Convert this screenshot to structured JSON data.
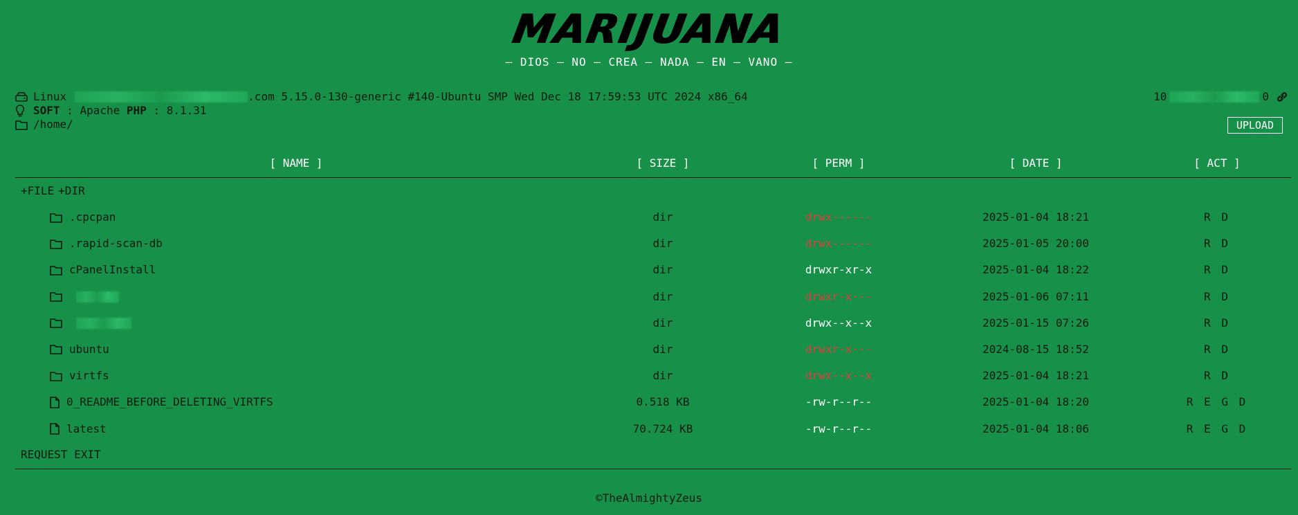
{
  "header": {
    "logo": "MARIJUANA",
    "tagline": "— DIOS — NO — CREA — NADA — EN — VANO —"
  },
  "sysinfo": {
    "os_prefix": "Linux",
    "host_suffix": ".com 5.15.0-130-generic #140-Ubuntu SMP Wed Dec 18 17:59:53 UTC 2024 x86_64",
    "soft_label": "SOFT",
    "soft_sep": ":",
    "soft_value": "Apache",
    "php_label": "PHP",
    "php_sep": ":",
    "php_value": "8.1.31",
    "path": "/home/",
    "ip_prefix": "10",
    "ip_suffix": "0"
  },
  "upload_label": "UPLOAD",
  "table": {
    "headers": {
      "name": "[ NAME ]",
      "size": "[ SIZE ]",
      "perm": "[ PERM ]",
      "date": "[ DATE ]",
      "act": "[ ACT ]"
    },
    "new_file": "+FILE",
    "new_dir": "+DIR",
    "rows": [
      {
        "type": "dir",
        "name": ".cpcpan",
        "size": "dir",
        "perm": "drwx------",
        "perm_color": "red",
        "date": "2025-01-04 18:21",
        "act": "R D"
      },
      {
        "type": "dir",
        "name": ".rapid-scan-db",
        "size": "dir",
        "perm": "drwx------",
        "perm_color": "red",
        "date": "2025-01-05 20:00",
        "act": "R D"
      },
      {
        "type": "dir",
        "name": "cPanelInstall",
        "size": "dir",
        "perm": "drwxr-xr-x",
        "perm_color": "white",
        "date": "2025-01-04 18:22",
        "act": "R D"
      },
      {
        "type": "dir",
        "name": "",
        "size": "dir",
        "perm": "drwxr-x---",
        "perm_color": "red",
        "date": "2025-01-06 07:11",
        "act": "R D"
      },
      {
        "type": "dir",
        "name": "",
        "size": "dir",
        "perm": "drwx--x--x",
        "perm_color": "white",
        "date": "2025-01-15 07:26",
        "act": "R D"
      },
      {
        "type": "dir",
        "name": "ubuntu",
        "size": "dir",
        "perm": "drwxr-x---",
        "perm_color": "red",
        "date": "2024-08-15 18:52",
        "act": "R D"
      },
      {
        "type": "dir",
        "name": "virtfs",
        "size": "dir",
        "perm": "drwx--x--x",
        "perm_color": "red",
        "date": "2025-01-04 18:21",
        "act": "R D"
      },
      {
        "type": "file",
        "name": "0_README_BEFORE_DELETING_VIRTFS",
        "size": "0.518 KB",
        "perm": "-rw-r--r--",
        "perm_color": "white",
        "date": "2025-01-04 18:20",
        "act": "R E G D"
      },
      {
        "type": "file",
        "name": "latest",
        "size": "70.724 KB",
        "perm": "-rw-r--r--",
        "perm_color": "white",
        "date": "2025-01-04 18:06",
        "act": "R E G D"
      }
    ],
    "request_exit": "REQUEST EXIT"
  },
  "footer": {
    "copyright": "©TheAlmightyZeus"
  },
  "colors": {
    "background": "#17914a",
    "text": "#0a1a0f",
    "perm_red": "#e23b3b",
    "perm_white": "#ffffff"
  }
}
